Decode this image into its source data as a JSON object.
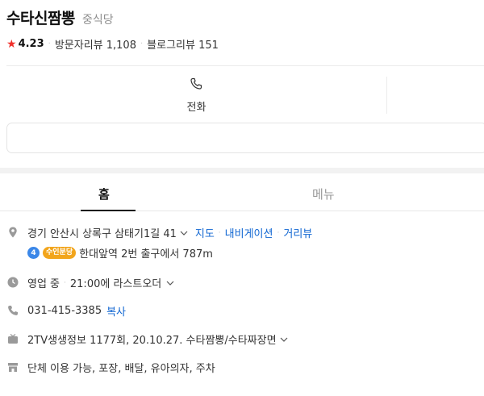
{
  "place": {
    "name": "수타신짬뽕",
    "category": "중식당",
    "rating": "4.23",
    "visitor_reviews": "방문자리뷰 1,108",
    "blog_reviews": "블로그리뷰 151"
  },
  "actions": {
    "call_label": "전화"
  },
  "tabs": [
    {
      "label": "홈",
      "active": true
    },
    {
      "label": "메뉴",
      "active": false
    }
  ],
  "info": {
    "address": "경기 안산시 상록구 삼태기1길 41",
    "address_links": [
      "지도",
      "내비게이션",
      "거리뷰"
    ],
    "subway": {
      "line_number": "4",
      "line_name": "수인분당",
      "text": "한대앞역 2번 출구에서 787m"
    },
    "hours": "영업 중",
    "last_order": "21:00에 라스트오더",
    "phone": "031-415-3385",
    "copy_label": "복사",
    "tv_info": "2TV생생정보 1177회, 20.10.27. 수타짬뽕/수타짜장면",
    "facilities": "단체 이용 가능, 포장, 배달, 유아의자, 주차"
  },
  "colors": {
    "link": "#1066d2",
    "star": "#f0302b",
    "line4": "#3b87e8",
    "suin_bundang": "#f2a51c"
  }
}
